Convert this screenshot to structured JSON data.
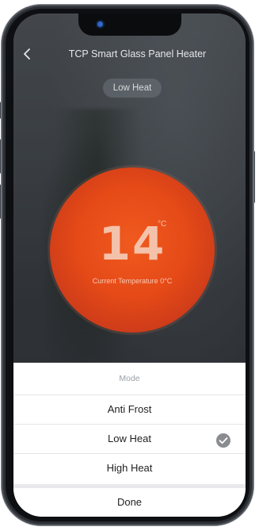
{
  "header": {
    "title": "TCP Smart Glass Panel Heater",
    "back_icon": "chevron-left-icon"
  },
  "mode_pill": {
    "label": "Low Heat"
  },
  "temperature": {
    "value": "14",
    "unit": "°C",
    "caption": "Current Temperature 0°C",
    "circle_color": "#e54a17"
  },
  "mode_sheet": {
    "title": "Mode",
    "options": [
      {
        "label": "Anti Frost",
        "selected": false
      },
      {
        "label": "Low Heat",
        "selected": true
      },
      {
        "label": "High Heat",
        "selected": false
      }
    ],
    "check_icon": "check-circle-icon",
    "done_label": "Done"
  },
  "colors": {
    "accent": "#e54a17",
    "check": "#8a8c90",
    "sheet_bg": "#ffffff"
  }
}
